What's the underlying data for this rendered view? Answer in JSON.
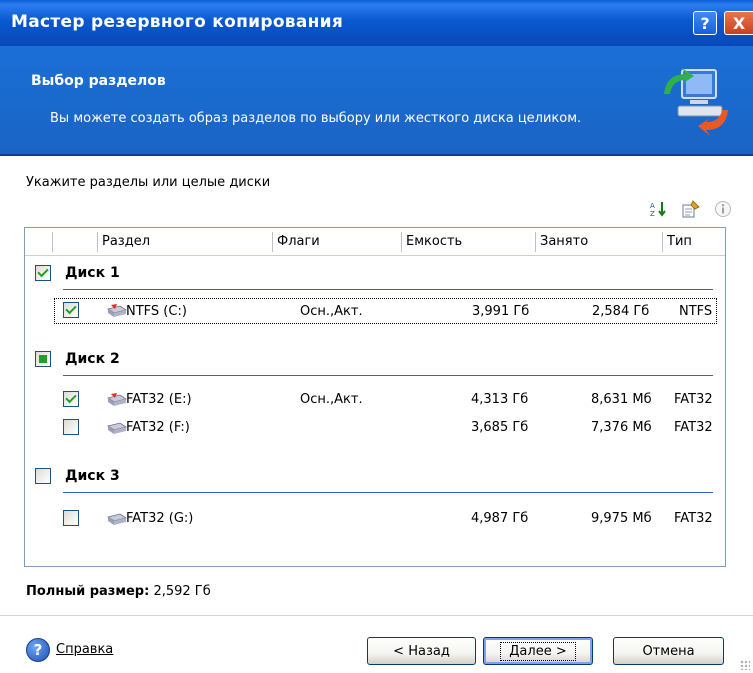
{
  "window": {
    "title": "Мастер резервного копирования",
    "help_btn": "?",
    "close_btn": "X"
  },
  "banner": {
    "title": "Выбор разделов",
    "subtitle": "Вы можете создать образ разделов по выбору или жесткого диска целиком."
  },
  "instruction": "Укажите разделы или целые диски",
  "toolbar": {
    "icons": [
      "sort-icon",
      "properties-icon",
      "info-icon"
    ]
  },
  "columns": [
    "Раздел",
    "Флаги",
    "Емкость",
    "Занято",
    "Тип"
  ],
  "disks": [
    {
      "label": "Диск 1",
      "state": "checked",
      "partitions": [
        {
          "name": "NTFS (C:)",
          "flags": "Осн.,Акт.",
          "capacity": "3,991 Гб",
          "used": "2,584 Гб",
          "type": "NTFS",
          "checked": true,
          "selected": true
        }
      ]
    },
    {
      "label": "Диск 2",
      "state": "partial",
      "partitions": [
        {
          "name": "FAT32 (E:)",
          "flags": "Осн.,Акт.",
          "capacity": "4,313 Гб",
          "used": "8,631 Мб",
          "type": "FAT32",
          "checked": true,
          "selected": false
        },
        {
          "name": "FAT32 (F:)",
          "flags": "",
          "capacity": "3,685 Гб",
          "used": "7,376 Мб",
          "type": "FAT32",
          "checked": false,
          "selected": false
        }
      ]
    },
    {
      "label": "Диск 3",
      "state": "unchecked",
      "partitions": [
        {
          "name": "FAT32 (G:)",
          "flags": "",
          "capacity": "4,987 Гб",
          "used": "9,975 Мб",
          "type": "FAT32",
          "checked": false,
          "selected": false
        }
      ]
    }
  ],
  "total": {
    "label": "Полный размер:",
    "value": "2,592 Гб"
  },
  "footer": {
    "help_link": "Справка",
    "back_button": "< Назад",
    "next_button": "Далее >",
    "cancel_button": "Отмена"
  },
  "colors": {
    "title_bar": "#0a58d0",
    "banner": "#1a64c4",
    "check_green": "#21a121",
    "disk_underline": "#3060c0"
  }
}
